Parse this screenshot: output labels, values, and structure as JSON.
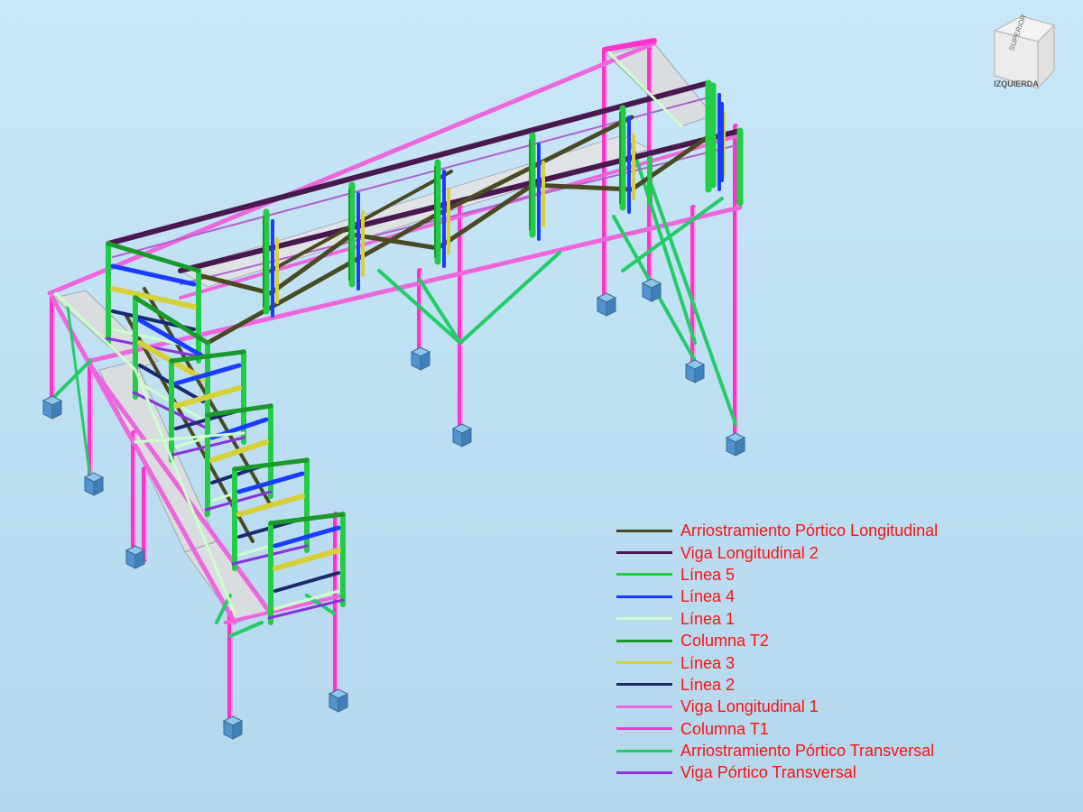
{
  "viewcube": {
    "top_face_label": "SUPERIOR",
    "left_face_label": "IZQUIERDA"
  },
  "colors": {
    "background": "#c2e2f5",
    "column_t1": "#ff33cc",
    "viga_longitudinal_1": "#ee66dd",
    "viga_longitudinal_2": "#4a1850",
    "arriostramiento_longitudinal": "#4a4a22",
    "arriostramiento_transversal": "#22cc66",
    "columna_t2": "#1a9a2a",
    "linea_1": "#ccffcc",
    "linea_2": "#1a2a70",
    "linea_3": "#d6d03a",
    "linea_4": "#1a3cff",
    "linea_5": "#22cc44",
    "viga_portico_transversal": "#8833dd",
    "deck": "#d9dde0",
    "footing": "#5aa0d8",
    "legend_text": "#ff1010"
  },
  "legend": {
    "items": [
      {
        "label": "Arriostramiento Pórtico Longitudinal",
        "color": "#4a4a22"
      },
      {
        "label": "Viga Longitudinal 2",
        "color": "#4a1850"
      },
      {
        "label": "Línea 5",
        "color": "#22cc44"
      },
      {
        "label": "Línea 4",
        "color": "#1a3cff"
      },
      {
        "label": "Línea 1",
        "color": "#ccffcc"
      },
      {
        "label": "Columna T2",
        "color": "#1a9a2a"
      },
      {
        "label": "Línea 3",
        "color": "#d6d03a"
      },
      {
        "label": "Línea 2",
        "color": "#1a2a70"
      },
      {
        "label": "Viga Longitudinal 1",
        "color": "#ee66dd"
      },
      {
        "label": "Columna T1",
        "color": "#ff33cc"
      },
      {
        "label": "Arriostramiento Pórtico Transversal",
        "color": "#22cc66"
      },
      {
        "label": "Viga Pórtico Transversal",
        "color": "#8833dd"
      }
    ]
  }
}
